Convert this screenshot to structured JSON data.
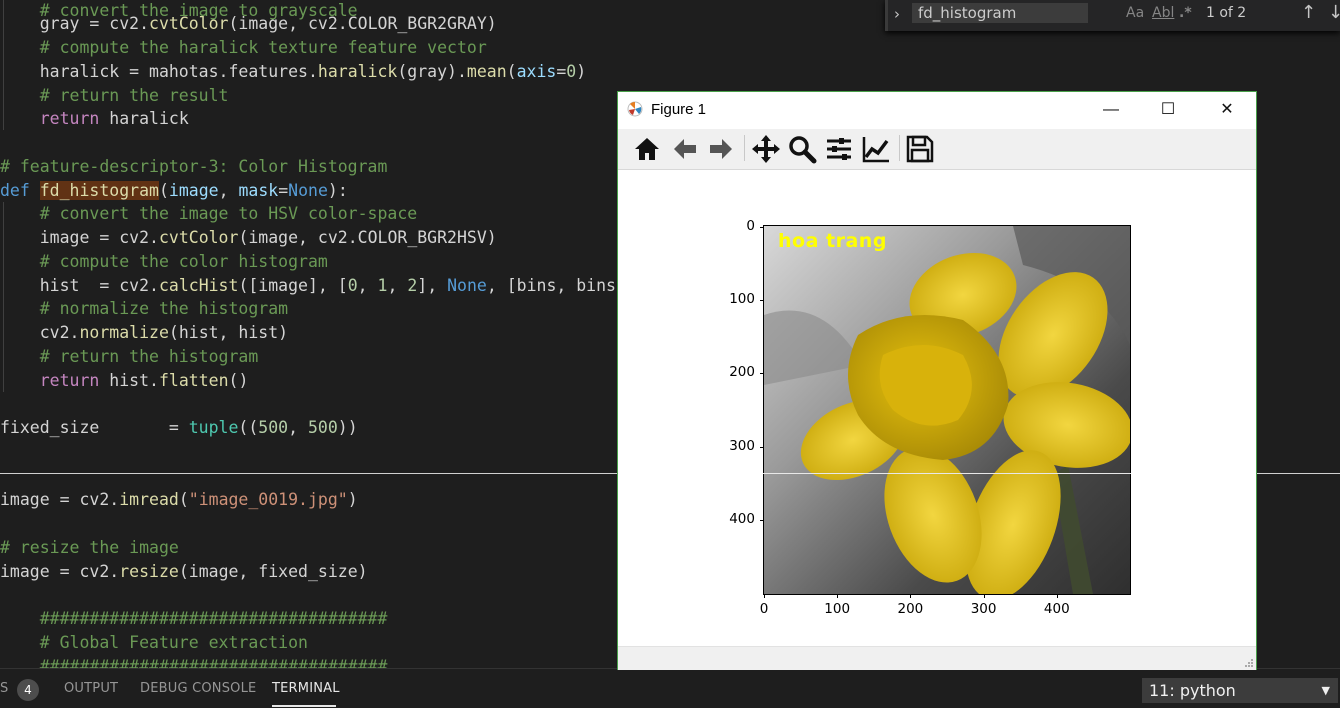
{
  "editor": {
    "lines": [
      {
        "y": -1,
        "indent": 38,
        "tokens": [
          [
            "    # convert the image to grayscale",
            "t-cm"
          ]
        ]
      },
      {
        "y": 12,
        "tokens": [
          [
            "    gray = cv2.",
            "t-pl"
          ],
          [
            "cvtColor",
            "t-fn"
          ],
          [
            "(image, cv2.COLOR_BGR2GRAY)",
            "t-pl"
          ]
        ]
      },
      {
        "y": 36,
        "tokens": [
          [
            "    # compute the haralick texture feature vector",
            "t-cm"
          ]
        ]
      },
      {
        "y": 60,
        "tokens": [
          [
            "    haralick = mahotas.features.",
            "t-pl"
          ],
          [
            "haralick",
            "t-fn"
          ],
          [
            "(gray).",
            "t-pl"
          ],
          [
            "mean",
            "t-fn"
          ],
          [
            "(",
            "t-pl"
          ],
          [
            "axis",
            "t-pm"
          ],
          [
            "=",
            "t-op"
          ],
          [
            "0",
            "t-nm"
          ],
          [
            ")",
            "t-pl"
          ]
        ]
      },
      {
        "y": 84,
        "tokens": [
          [
            "    # return the result",
            "t-cm"
          ]
        ]
      },
      {
        "y": 107,
        "tokens": [
          [
            "    ",
            "t-pl"
          ],
          [
            "return",
            "t-kw"
          ],
          [
            " haralick",
            "t-pl"
          ]
        ]
      },
      {
        "y": 155,
        "tokens": [
          [
            "# feature-descriptor-3: Color Histogram",
            "t-cm"
          ]
        ]
      },
      {
        "y": 179,
        "tokens": [
          [
            "def",
            "t-df"
          ],
          [
            " ",
            "t-pl"
          ],
          [
            "fd_histogram",
            "t-hl"
          ],
          [
            "(",
            "t-pl"
          ],
          [
            "image",
            "t-pm"
          ],
          [
            ", ",
            "t-pl"
          ],
          [
            "mask",
            "t-pm"
          ],
          [
            "=",
            "t-op"
          ],
          [
            "None",
            "t-nn"
          ],
          [
            "):",
            "t-pl"
          ]
        ]
      },
      {
        "y": 202,
        "tokens": [
          [
            "    # convert the image to HSV color-space",
            "t-cm"
          ]
        ]
      },
      {
        "y": 226,
        "tokens": [
          [
            "    image = cv2.",
            "t-pl"
          ],
          [
            "cvtColor",
            "t-fn"
          ],
          [
            "(image, cv2.COLOR_BGR2HSV)",
            "t-pl"
          ]
        ]
      },
      {
        "y": 250,
        "tokens": [
          [
            "    # compute the color histogram",
            "t-cm"
          ]
        ]
      },
      {
        "y": 274,
        "tokens": [
          [
            "    hist  = cv2.",
            "t-pl"
          ],
          [
            "calcHist",
            "t-fn"
          ],
          [
            "([image], [",
            "t-pl"
          ],
          [
            "0",
            "t-nm"
          ],
          [
            ", ",
            "t-pl"
          ],
          [
            "1",
            "t-nm"
          ],
          [
            ", ",
            "t-pl"
          ],
          [
            "2",
            "t-nm"
          ],
          [
            "], ",
            "t-pl"
          ],
          [
            "None",
            "t-nn"
          ],
          [
            ", [bins, bins,",
            "t-pl"
          ]
        ]
      },
      {
        "y": 297,
        "tokens": [
          [
            "    # normalize the histogram",
            "t-cm"
          ]
        ]
      },
      {
        "y": 321,
        "tokens": [
          [
            "    cv2.",
            "t-pl"
          ],
          [
            "normalize",
            "t-fn"
          ],
          [
            "(hist, hist)",
            "t-pl"
          ]
        ]
      },
      {
        "y": 345,
        "tokens": [
          [
            "    # return the histogram",
            "t-cm"
          ]
        ]
      },
      {
        "y": 369,
        "tokens": [
          [
            "    ",
            "t-pl"
          ],
          [
            "return",
            "t-kw"
          ],
          [
            " hist.",
            "t-pl"
          ],
          [
            "flatten",
            "t-fn"
          ],
          [
            "()",
            "t-pl"
          ]
        ]
      },
      {
        "y": 416,
        "tokens": [
          [
            "fixed_size       = ",
            "t-pl"
          ],
          [
            "tuple",
            "t-bi"
          ],
          [
            "((",
            "t-pl"
          ],
          [
            "500",
            "t-nm"
          ],
          [
            ", ",
            "t-pl"
          ],
          [
            "500",
            "t-nm"
          ],
          [
            "))",
            "t-pl"
          ]
        ]
      },
      {
        "y": 488,
        "tokens": [
          [
            "image = cv2.",
            "t-pl"
          ],
          [
            "imread",
            "t-fn"
          ],
          [
            "(",
            "t-pl"
          ],
          [
            "\"image_0019.jpg\"",
            "t-st"
          ],
          [
            ")",
            "t-pl"
          ]
        ]
      },
      {
        "y": 536,
        "tokens": [
          [
            "# resize the image",
            "t-cm"
          ]
        ]
      },
      {
        "y": 560,
        "tokens": [
          [
            "image = cv2.",
            "t-pl"
          ],
          [
            "resize",
            "t-fn"
          ],
          [
            "(image, fixed_size)",
            "t-pl"
          ]
        ]
      },
      {
        "y": 607,
        "tokens": [
          [
            "    ###################################",
            "t-cm"
          ]
        ]
      },
      {
        "y": 631,
        "tokens": [
          [
            "    # Global Feature extraction",
            "t-cm"
          ]
        ]
      },
      {
        "y": 655,
        "tokens": [
          [
            "    ###################################",
            "t-cm"
          ]
        ]
      }
    ]
  },
  "find": {
    "value": "fd_histogram",
    "match_case": "Aa",
    "whole_word": "Abl",
    "regex": ".*",
    "count": "1 of 2",
    "prev": "↑",
    "next": "↓"
  },
  "panel": {
    "problems_tab": "S",
    "problems_count": "4",
    "output_tab": "OUTPUT",
    "debug_tab": "DEBUG CONSOLE",
    "terminal_tab": "TERMINAL",
    "terminal_select": "11: python"
  },
  "figure": {
    "title": "Figure 1",
    "minimize": "—",
    "maximize": "☐",
    "close": "✕",
    "toolbar": [
      "home-icon",
      "back-arrow-icon",
      "forward-arrow-icon",
      "pan-icon",
      "zoom-icon",
      "subplots-icon",
      "edit-curves-icon",
      "save-icon"
    ],
    "image_text": "hoa trang",
    "image_text_color": "#ffff00",
    "xticks": [
      "0",
      "100",
      "200",
      "300",
      "400"
    ],
    "yticks": [
      "0",
      "100",
      "200",
      "300",
      "400"
    ]
  }
}
